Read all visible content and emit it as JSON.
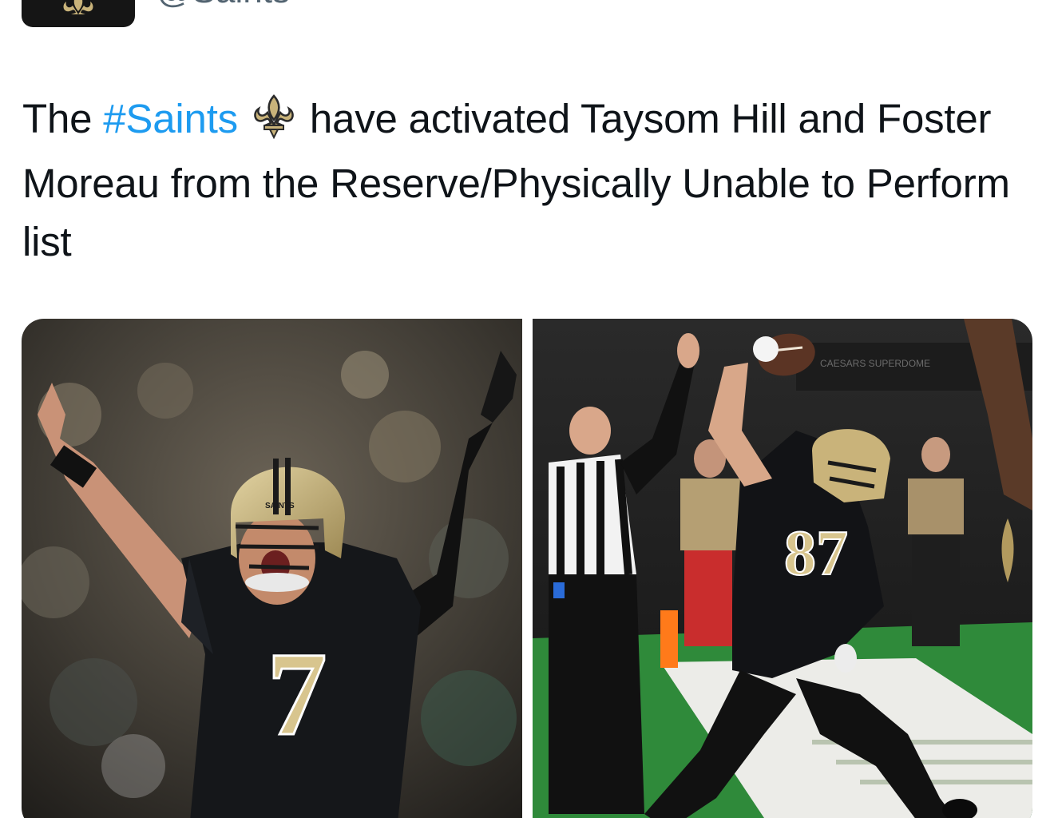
{
  "account": {
    "handle": "@Saints",
    "avatar_icon": "fleur-de-lis-icon"
  },
  "tweet": {
    "text_before": "The ",
    "hashtag": "#Saints",
    "emoji_icon": "fleur-de-lis-emoji",
    "text_after": " have activated Taysom Hill and Foster Moreau from the Reserve/Physically Unable to Perform list"
  },
  "media": {
    "left_photo": {
      "jersey_number": "7",
      "helmet_text": "SAINTS"
    },
    "right_photo": {
      "jersey_number": "87",
      "banner_text": "CAESARS SUPERDOME"
    }
  },
  "colors": {
    "hashtag": "#1d9bf0",
    "saints_gold": "#c9b37a",
    "saints_black": "#151515"
  }
}
